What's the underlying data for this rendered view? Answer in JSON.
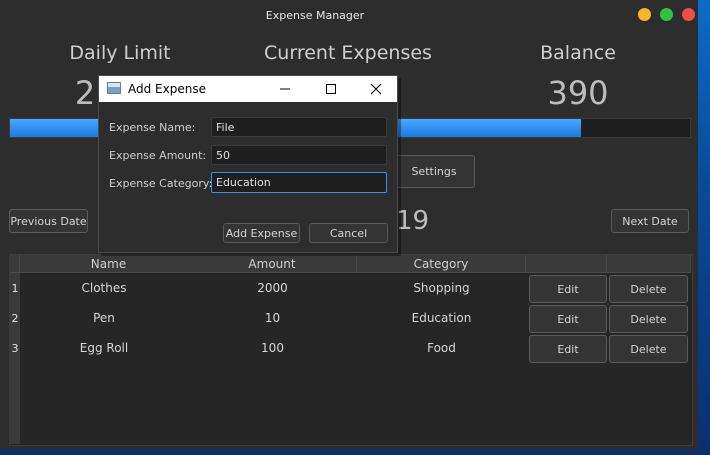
{
  "app": {
    "title": "Expense Manager"
  },
  "stats": [
    {
      "label": "Daily Limit",
      "value": "2"
    },
    {
      "label": "Current Expenses",
      "value": ""
    },
    {
      "label": "Balance",
      "value": "390"
    }
  ],
  "progress": {
    "fraction": 0.84
  },
  "buttons": {
    "settings": "Settings",
    "previous_date": "Previous Date",
    "next_date": "Next Date"
  },
  "date_display": "19",
  "table": {
    "columns": [
      "Name",
      "Amount",
      "Category",
      "",
      ""
    ],
    "rows": [
      {
        "num": "1",
        "name": "Clothes",
        "amount": "2000",
        "category": "Shopping",
        "edit": "Edit",
        "delete": "Delete"
      },
      {
        "num": "2",
        "name": "Pen",
        "amount": "10",
        "category": "Education",
        "edit": "Edit",
        "delete": "Delete"
      },
      {
        "num": "3",
        "name": "Egg Roll",
        "amount": "100",
        "category": "Food",
        "edit": "Edit",
        "delete": "Delete"
      }
    ]
  },
  "dialog": {
    "title": "Add Expense",
    "name_label": "Expense Name:",
    "name_value": "File",
    "amount_label": "Expense Amount:",
    "amount_value": "50",
    "category_label": "Expense Category:",
    "category_value": "Education",
    "add_button": "Add Expense",
    "cancel_button": "Cancel"
  },
  "colors": {
    "accent": "#2a8df0",
    "background": "#2d2d2d",
    "close": "#f14b4b",
    "minimize": "#f5b52d",
    "maximize": "#2fc43f"
  }
}
